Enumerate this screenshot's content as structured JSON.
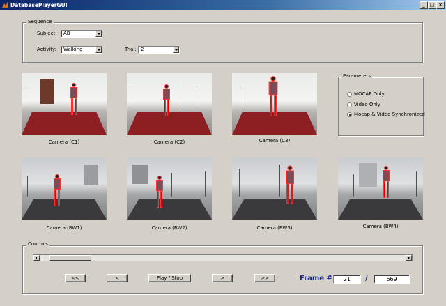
{
  "window": {
    "title": "DatabasePlayerGUI"
  },
  "sequence": {
    "label": "Sequence",
    "subject_label": "Subject:",
    "subject_value": "AB",
    "activity_label": "Activity:",
    "activity_value": "Walking",
    "trial_label": "Trial:",
    "trial_value": "2"
  },
  "cameras": {
    "top": [
      "Camera (C1)",
      "Camera (C2)",
      "Camera (C3)"
    ],
    "bottom": [
      "Camera (BW1)",
      "Camera (BW2)",
      "Camera (BW3)",
      "Camera (BW4)"
    ]
  },
  "parameters": {
    "label": "Parameters",
    "options": [
      "MOCAP Only",
      "Video Only",
      "Mocap & Video Synchronized"
    ],
    "selected_index": 2
  },
  "controls": {
    "label": "Controls",
    "slider_progress": 0.031,
    "buttons": {
      "rewind": "<<",
      "step_back": "<",
      "play_stop": "Play / Stop",
      "step_forward": ">",
      "fast_forward": ">>"
    },
    "frame_label": "Frame #:",
    "frame_current": "21",
    "frame_separator": "/",
    "frame_total": "669"
  },
  "colors": {
    "title_bar": "#0a246a",
    "frame_label": "#1a2a8c",
    "marker": "#ff3030"
  }
}
